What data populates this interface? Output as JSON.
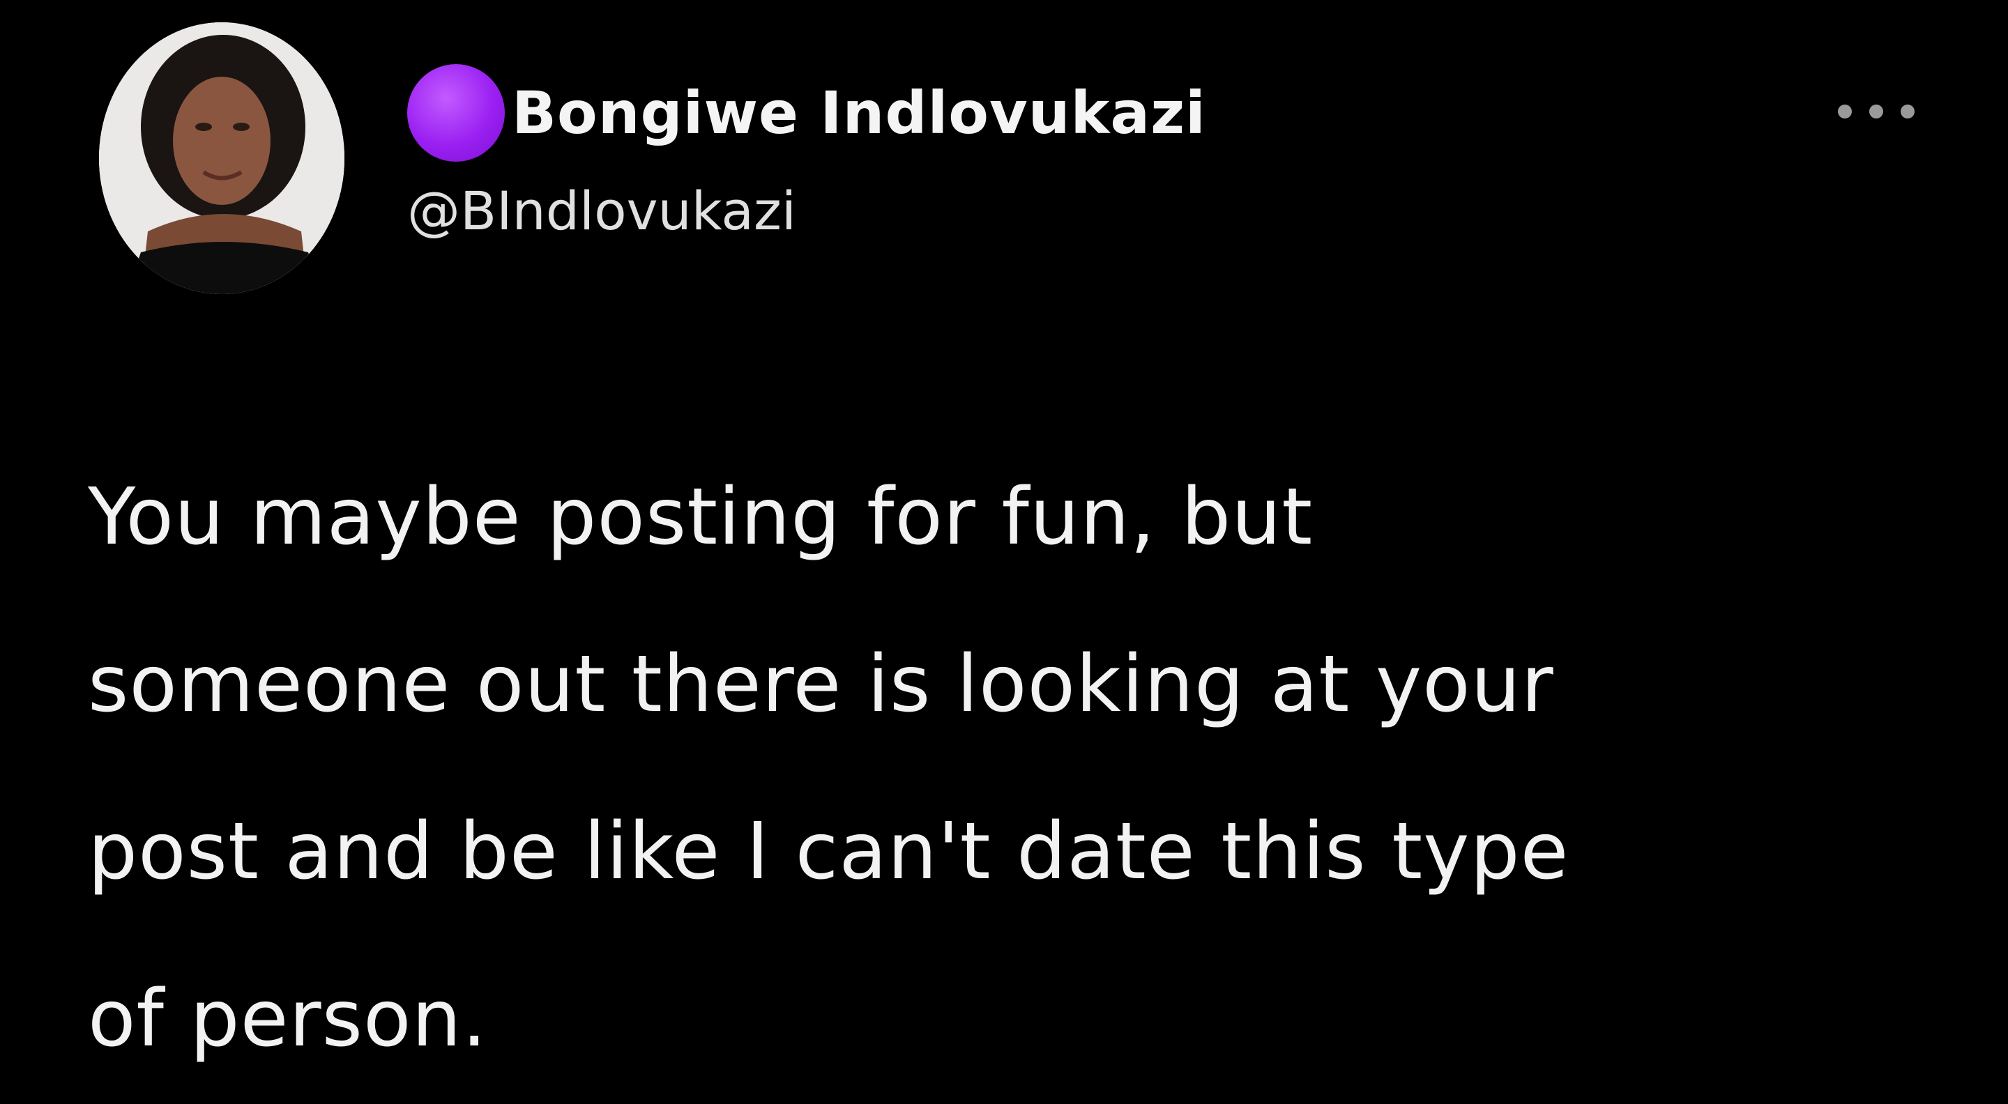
{
  "tweet": {
    "display_name": "Bongiwe Indlovukazi",
    "handle": "@BIndlovukazi",
    "name_emoji": "purple-circle-icon",
    "more_icon": "more-options-icon",
    "text": "You maybe posting for fun, but\nsomeone out there is looking at your\npost and be like I can't date this type\nof person."
  },
  "colors": {
    "background": "#000000",
    "text": "#f2f2f2",
    "emoji_purple": "#9a20f2"
  }
}
